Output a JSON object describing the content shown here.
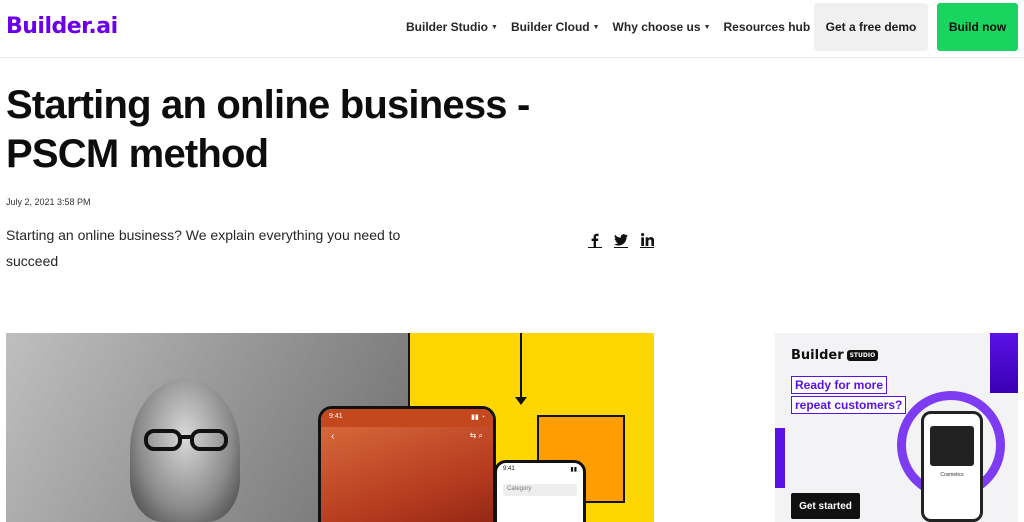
{
  "header": {
    "logo_text": "Builder.ai",
    "nav": [
      {
        "label": "Builder Studio"
      },
      {
        "label": "Builder Cloud"
      },
      {
        "label": "Why choose us"
      },
      {
        "label": "Resources hub"
      }
    ],
    "demo_label": "Get a free demo",
    "build_label": "Build now"
  },
  "article": {
    "title_line1": "Starting an online business -",
    "title_line2": "PSCM method",
    "date": "July 2, 2021 3:58 PM",
    "subtitle": "Starting an online business? We explain everything you need to succeed",
    "share_icons": [
      "facebook-icon",
      "twitter-icon",
      "linkedin-icon"
    ]
  },
  "hero": {
    "phone_time": "9:41",
    "phone2_time": "9:41",
    "search_placeholder": "Category"
  },
  "ad": {
    "logo": "Builder",
    "logo_tag": "STUDIO",
    "headline_line1": "Ready for more",
    "headline_line2": "repeat customers?",
    "phone_caption": "Cosmetics",
    "cta": "Get started"
  },
  "colors": {
    "brand": "#6c00ea",
    "cta_green": "#19d45e",
    "hero_yellow": "#ffd600",
    "accent_orange": "#ff9e00",
    "ad_purple": "#5a12e6"
  }
}
